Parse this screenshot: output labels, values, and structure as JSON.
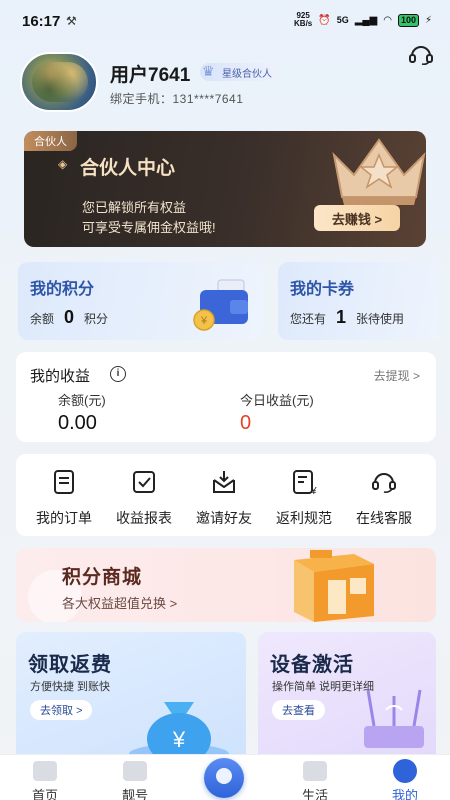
{
  "status": {
    "time": "16:17",
    "net_speed_top": "925",
    "net_speed_unit": "KB/s",
    "network": "5G",
    "battery": "100"
  },
  "profile": {
    "username": "用户7641",
    "badge": "星级合伙人",
    "phone": "绑定手机：131****7641"
  },
  "partner": {
    "tag": "合伙人",
    "title": "合伙人中心",
    "line1": "您已解锁所有权益",
    "line2": "可享受专属佣金权益哦!",
    "button": "去赚钱 >"
  },
  "points": {
    "title": "我的积分",
    "prefix": "余额",
    "value": "0",
    "suffix": "积分"
  },
  "coupons": {
    "title": "我的卡券",
    "prefix": "您还有",
    "value": "1",
    "suffix": "张待使用"
  },
  "earnings": {
    "title": "我的收益",
    "withdraw": "去提现 >",
    "balance_label": "余额(元)",
    "balance_value": "0.00",
    "today_label": "今日收益(元)",
    "today_value": "0",
    "today_color": "#e8412b"
  },
  "shortcuts": [
    {
      "label": "我的订单",
      "icon": "order-icon"
    },
    {
      "label": "收益报表",
      "icon": "report-icon"
    },
    {
      "label": "邀请好友",
      "icon": "invite-icon"
    },
    {
      "label": "返利规范",
      "icon": "rebate-rules-icon"
    },
    {
      "label": "在线客服",
      "icon": "customer-service-icon"
    }
  ],
  "mall": {
    "title": "积分商城",
    "subtitle": "各大权益超值兑换 >"
  },
  "refund": {
    "title": "领取返费",
    "subtitle": "方便快捷  到账快",
    "button": "去领取 >"
  },
  "activate": {
    "title": "设备激活",
    "subtitle": "操作简单  说明更详细",
    "button": "去查看"
  },
  "nav": {
    "home": "首页",
    "number": "靓号",
    "life": "生活",
    "mine": "我的",
    "accent": "#2f63d9"
  }
}
